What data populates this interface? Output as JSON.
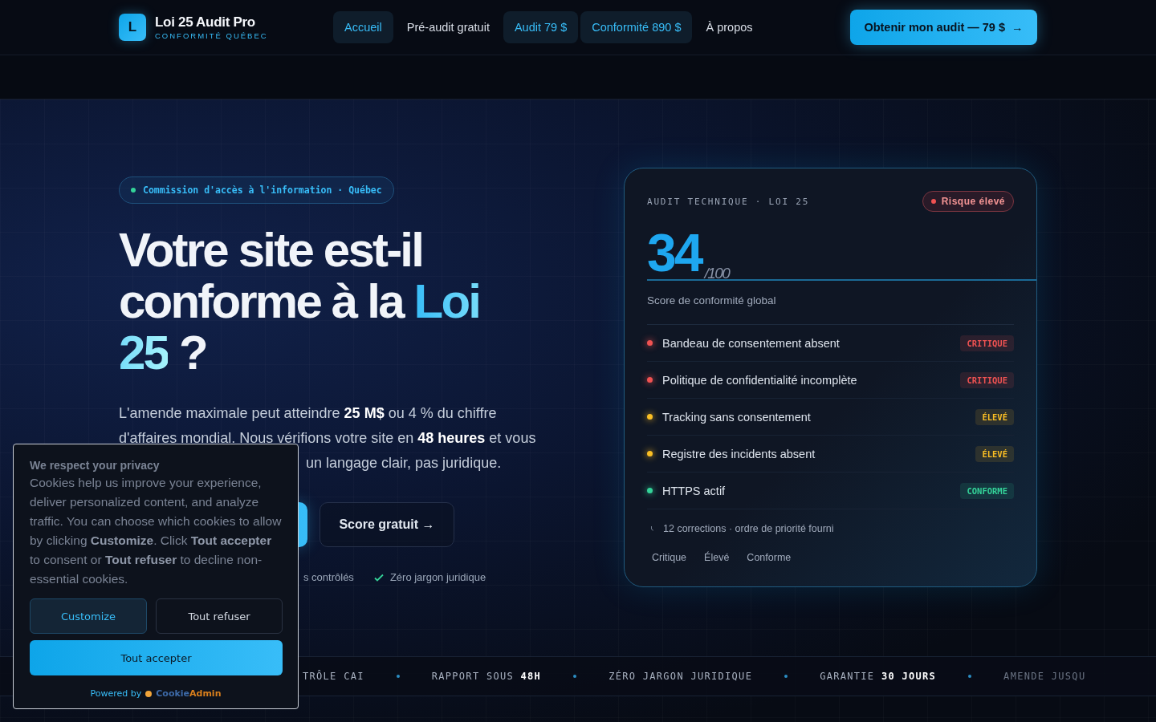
{
  "header": {
    "logo_letter": "L",
    "brand": "Loi 25 Audit Pro",
    "tagline": "CONFORMITÉ QUÉBEC",
    "nav": [
      {
        "label": "Accueil",
        "kind": "pill"
      },
      {
        "label": "Pré-audit gratuit",
        "kind": "link"
      },
      {
        "label": "Audit 79 $",
        "kind": "pill"
      },
      {
        "label": "Conformité 890 $",
        "kind": "pill"
      },
      {
        "label": "À propos",
        "kind": "link"
      }
    ],
    "cta": {
      "label": "Obtenir mon audit — 79 $",
      "arrow": "→"
    }
  },
  "hero": {
    "eyebrow": "Commission d'accès à l'information · Québec",
    "title_before": "Votre site est-il conforme à la ",
    "title_accent": "Loi 25",
    "title_after": " ?",
    "paragraph": "L'amende maximale peut atteindre **25 M$** ou 4 % du chiffre d'affaires mondial. Nous vérifions votre site en **48 heures** et vous",
    "paragraph_tail": "un langage clair, pas juridique.",
    "secondary_button": "Score gratuit →",
    "checks": [
      {
        "text": "s contrôlés",
        "icon": false
      },
      {
        "text": "Zéro jargon juridique",
        "icon": true
      }
    ]
  },
  "audit_card": {
    "eyebrow": "AUDIT TECHNIQUE · LOI 25",
    "risk": "Risque élevé",
    "score": "34",
    "score_max": "/100",
    "score_label": "Score de conformité global",
    "items": [
      {
        "label": "Bandeau de consentement absent",
        "tag": "CRITIQUE",
        "color": "#f05252"
      },
      {
        "label": "Politique de confidentialité incomplète",
        "tag": "CRITIQUE",
        "color": "#f05252"
      },
      {
        "label": "Tracking sans consentement",
        "tag": "ÉLEVÉ",
        "color": "#fbbf24"
      },
      {
        "label": "Registre des incidents absent",
        "tag": "ÉLEVÉ",
        "color": "#fbbf24"
      },
      {
        "label": "HTTPS actif",
        "tag": "CONFORME",
        "color": "#34d399"
      }
    ],
    "footer": "12 corrections · ordre de priorité fourni",
    "legend": [
      "Critique",
      "Élevé",
      "Conforme"
    ]
  },
  "ticker": [
    {
      "text": "TRÔLE CAI",
      "faded": false
    },
    {
      "text": "RAPPORT SOUS **48H**",
      "faded": false
    },
    {
      "text": "ZÉRO JARGON JURIDIQUE",
      "faded": false
    },
    {
      "text": "GARANTIE **30 JOURS**",
      "faded": false
    },
    {
      "text": "AMENDE JUSQU",
      "faded": true
    }
  ],
  "cookie_banner": {
    "title": "We respect your privacy",
    "body": "Cookies help us improve your experience, deliver personalized content, and analyze traffic. You can choose which cookies to allow by clicking **Customize**. Click **Tout accepter** to consent or **Tout refuser** to decline non-essential cookies.",
    "buttons": [
      {
        "label": "Customize",
        "kind": "customize"
      },
      {
        "label": "Tout refuser",
        "kind": "refuse"
      },
      {
        "label": "Tout accepter",
        "kind": "accept"
      }
    ],
    "powered_by": "Powered by",
    "brand_a": "Cookie",
    "brand_b": "Admin"
  }
}
